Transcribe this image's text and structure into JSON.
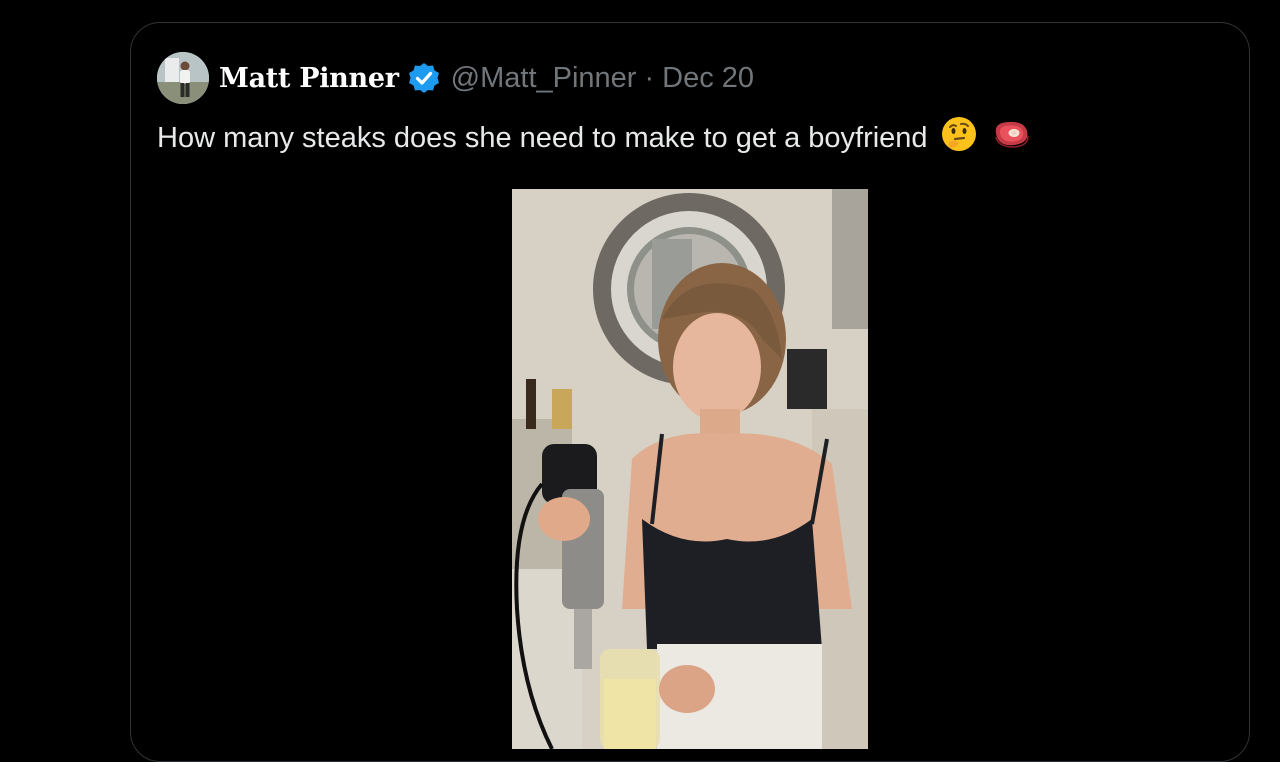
{
  "tweet": {
    "author_name": "Matt Pinner",
    "handle": "@Matt_Pinner",
    "separator": "·",
    "date": "Dec 20",
    "text": "How many steaks does she need to make to get a boyfriend",
    "emojis": [
      "thinking-face-emoji",
      "steak-emoji"
    ]
  },
  "icons": {
    "verified": "verified-badge-icon"
  },
  "colors": {
    "background": "#000000",
    "card_border": "#2f3336",
    "text_primary": "#e7e9ea",
    "text_secondary": "#71767b",
    "verified_blue": "#1d9bf0"
  }
}
